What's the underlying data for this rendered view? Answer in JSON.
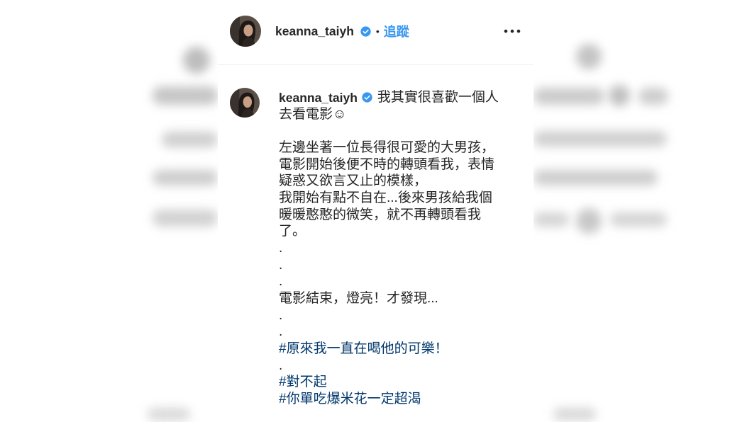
{
  "header": {
    "username": "keanna_taiyh",
    "verified_icon": "verified-badge-icon",
    "separator": "•",
    "follow_label": "追蹤",
    "more_icon": "more-options-icon"
  },
  "caption": {
    "username": "keanna_taiyh",
    "verified_icon": "verified-badge-icon",
    "lines": [
      "我其實很喜歡一個人",
      "去看電影☺",
      "左邊坐著一位長得很可愛的大男孩，",
      "電影開始後便不時的轉頭看我，表情",
      "疑惑又欲言又止的模樣，",
      "我開始有點不自在...後來男孩給我個",
      "暖暖憨憨的微笑，就不再轉頭看我",
      "了。",
      ".",
      ".",
      ".",
      "電影結束，燈亮！才發現...",
      ".",
      ".",
      "#原來我一直在喝他的可樂！",
      ".",
      "#對不起",
      "#你單吃爆米花一定超渴"
    ]
  },
  "colors": {
    "text": "#262626",
    "accent": "#3897f0",
    "hashtag": "#00376b",
    "divider": "#efefef"
  }
}
